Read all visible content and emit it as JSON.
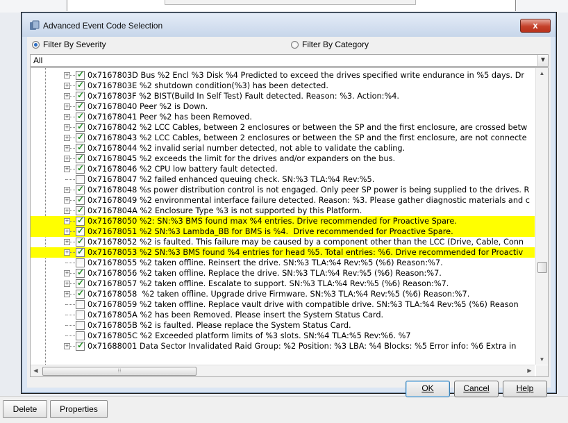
{
  "window": {
    "title": "Advanced Event Code Selection",
    "close_label": "x"
  },
  "filters": {
    "by_severity": "Filter By Severity",
    "by_category": "Filter By Category",
    "selected": "severity"
  },
  "combo": {
    "value": "All"
  },
  "rows": [
    {
      "text": "0x7167803D Bus %2 Encl %3 Disk %4 Predicted to exceed the drives specified write endurance in %5 days. Dr",
      "checked": true,
      "expander": true,
      "highlight": false
    },
    {
      "text": "0x7167803E %2 shutdown condition(%3) has been detected.",
      "checked": true,
      "expander": true,
      "highlight": false
    },
    {
      "text": "0x7167803F %2 BIST(Build In Self Test) Fault detected. Reason: %3. Action:%4.",
      "checked": true,
      "expander": true,
      "highlight": false
    },
    {
      "text": "0x71678040 Peer %2 is Down.",
      "checked": true,
      "expander": true,
      "highlight": false
    },
    {
      "text": "0x71678041 Peer %2 has been Removed.",
      "checked": true,
      "expander": true,
      "highlight": false
    },
    {
      "text": "0x71678042 %2 LCC Cables, between 2 enclosures or between the SP and the first enclosure, are crossed betw",
      "checked": true,
      "expander": true,
      "highlight": false
    },
    {
      "text": "0x71678043 %2 LCC Cables, between 2 enclosures or between the SP and the first enclosure, are not connecte",
      "checked": true,
      "expander": true,
      "highlight": false
    },
    {
      "text": "0x71678044 %2 invalid serial number detected, not able to validate the cabling.",
      "checked": true,
      "expander": true,
      "highlight": false
    },
    {
      "text": "0x71678045 %2 exceeds the limit for the drives and/or expanders on the bus.",
      "checked": true,
      "expander": true,
      "highlight": false
    },
    {
      "text": "0x71678046 %2 CPU low battery fault detected.",
      "checked": true,
      "expander": true,
      "highlight": false
    },
    {
      "text": "0x71678047 %2 failed enhanced queuing check. SN:%3 TLA:%4 Rev:%5.",
      "checked": false,
      "expander": false,
      "highlight": false
    },
    {
      "text": "0x71678048 %s power distribution control is not engaged. Only peer SP power is being supplied to the drives. R",
      "checked": true,
      "expander": true,
      "highlight": false
    },
    {
      "text": "0x71678049 %2 environmental interface failure detected. Reason: %3. Please gather diagnostic materials and c",
      "checked": true,
      "expander": true,
      "highlight": false
    },
    {
      "text": "0x7167804A %2 Enclosure Type %3 is not supported by this Platform.",
      "checked": true,
      "expander": true,
      "highlight": false
    },
    {
      "text": "0x71678050 %2: SN:%3 BMS found max %4 entries. Drive recommended for Proactive Spare.",
      "checked": true,
      "expander": true,
      "highlight": true
    },
    {
      "text": "0x71678051 %2 SN:%3 Lambda_BB for BMS is %4.  Drive recommended for Proactive Spare.",
      "checked": true,
      "expander": true,
      "highlight": true
    },
    {
      "text": "0x71678052 %2 is faulted. This failure may be caused by a component other than the LCC (Drive, Cable, Conn",
      "checked": true,
      "expander": true,
      "highlight": false
    },
    {
      "text": "0x71678053 %2 SN:%3 BMS found %4 entries for head %5. Total entries: %6. Drive recommended for Proactiv",
      "checked": true,
      "expander": true,
      "highlight": true
    },
    {
      "text": "0x71678055 %2 taken offline. Reinsert the drive. SN:%3 TLA:%4 Rev:%5 (%6) Reason:%7.",
      "checked": false,
      "expander": false,
      "highlight": false
    },
    {
      "text": "0x71678056 %2 taken offline. Replace the drive. SN:%3 TLA:%4 Rev:%5 (%6) Reason:%7.",
      "checked": true,
      "expander": true,
      "highlight": false
    },
    {
      "text": "0x71678057 %2 taken offline. Escalate to support. SN:%3 TLA:%4 Rev:%5 (%6) Reason:%7.",
      "checked": true,
      "expander": true,
      "highlight": false
    },
    {
      "text": "0x71678058  %2 taken offline. Upgrade drive Firmware. SN:%3 TLA:%4 Rev:%5 (%6) Reason:%7.",
      "checked": true,
      "expander": true,
      "highlight": false
    },
    {
      "text": "0x71678059 %2 taken offline. Replace vault drive with compatible drive. SN:%3 TLA:%4 Rev:%5 (%6) Reason",
      "checked": false,
      "expander": false,
      "highlight": false
    },
    {
      "text": "0x7167805A %2 has been Removed. Please insert the System Status Card.",
      "checked": false,
      "expander": false,
      "highlight": false
    },
    {
      "text": "0x7167805B %2 is faulted. Please replace the System Status Card.",
      "checked": false,
      "expander": false,
      "highlight": false
    },
    {
      "text": "0x7167805C %2 Exceeded platform limits of %3 slots. SN:%4 TLA:%5 Rev:%6. %7",
      "checked": false,
      "expander": false,
      "highlight": false
    },
    {
      "text": "0x71688001 Data Sector Invalidated Raid Group: %2 Position: %3 LBA: %4 Blocks: %5 Error info: %6 Extra in",
      "checked": true,
      "expander": true,
      "highlight": false
    }
  ],
  "buttons": {
    "ok": "OK",
    "cancel": "Cancel",
    "help": "Help"
  },
  "background": {
    "delete": "Delete",
    "properties": "Properties"
  }
}
